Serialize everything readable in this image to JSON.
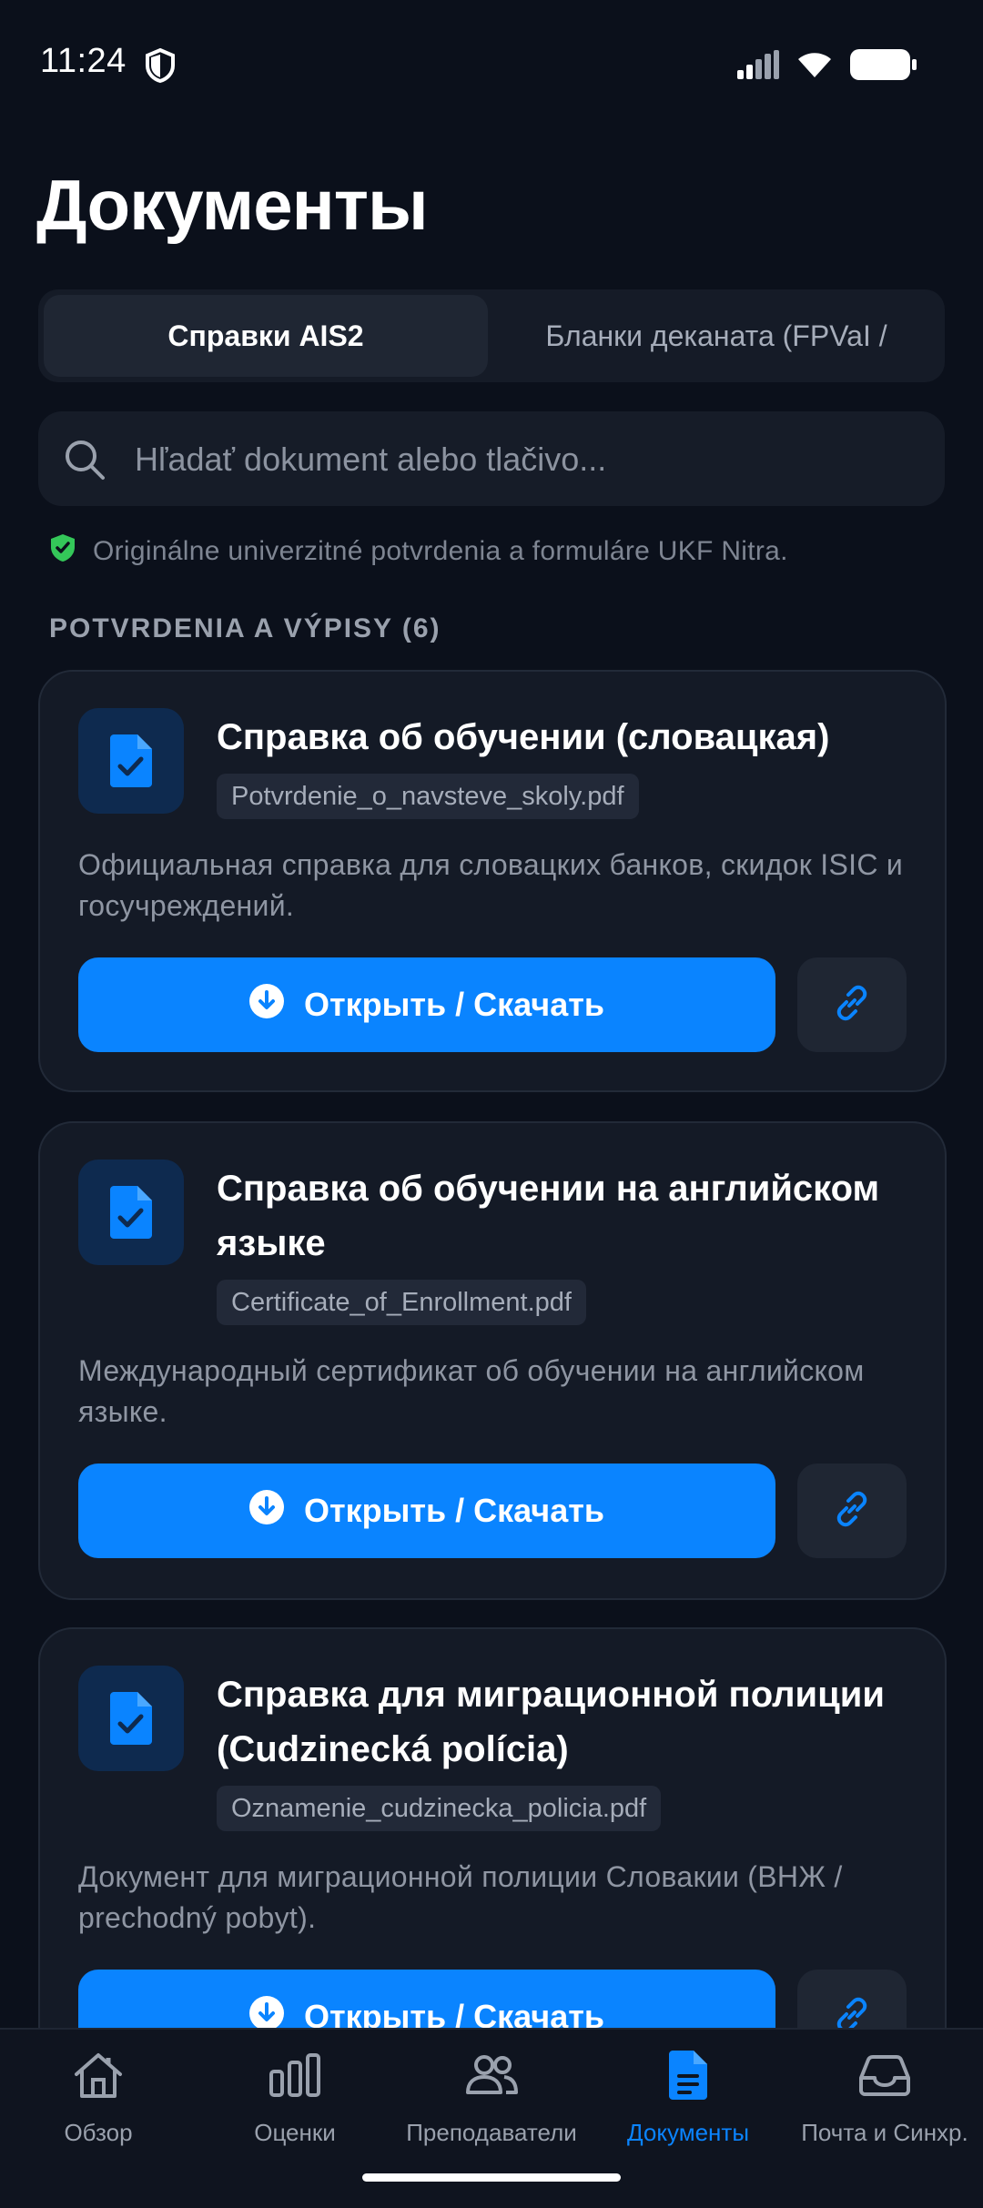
{
  "status_bar": {
    "time": "11:24"
  },
  "page_title": "Документы",
  "tabs": [
    {
      "label": "Справки AIS2",
      "active": true
    },
    {
      "label": "Бланки деканата (FPVaI /",
      "active": false
    }
  ],
  "search": {
    "placeholder": "Hľadať dokument alebo tlačivo..."
  },
  "info_note": "Originálne univerzitné potvrdenia a formuláre UKF Nitra.",
  "section": {
    "header": "POTVRDENIA A VÝPISY (6)"
  },
  "documents": [
    {
      "title": "Справка об обучении (словацкая)",
      "file": "Potvrdenie_o_navsteve_skoly.pdf",
      "description": "Официальная справка для словацких банков, скидок ISIC и госучреждений.",
      "button": "Открыть / Скачать"
    },
    {
      "title": "Справка об обучении на английском языке",
      "file": "Certificate_of_Enrollment.pdf",
      "description": "Международный сертификат об обучении на английском языке.",
      "button": "Открыть / Скачать"
    },
    {
      "title": "Справка для миграционной полиции (Cudzinecká polícia)",
      "file": "Oznamenie_cudzinecka_policia.pdf",
      "description": "Документ для миграционной полиции Словакии (ВНЖ / prechodný pobyt).",
      "button": "Открыть / Скачать"
    }
  ],
  "bottom_nav": [
    {
      "label": "Обзор",
      "icon": "home-icon",
      "active": false
    },
    {
      "label": "Оценки",
      "icon": "bar-chart-icon",
      "active": false
    },
    {
      "label": "Преподаватели",
      "icon": "people-icon",
      "active": false
    },
    {
      "label": "Документы",
      "icon": "document-icon",
      "active": true
    },
    {
      "label": "Почта и Синхр.",
      "icon": "inbox-icon",
      "active": false
    }
  ],
  "colors": {
    "accent": "#0a84ff",
    "background": "#0b101b",
    "card": "#141a26",
    "verified": "#34c759"
  }
}
